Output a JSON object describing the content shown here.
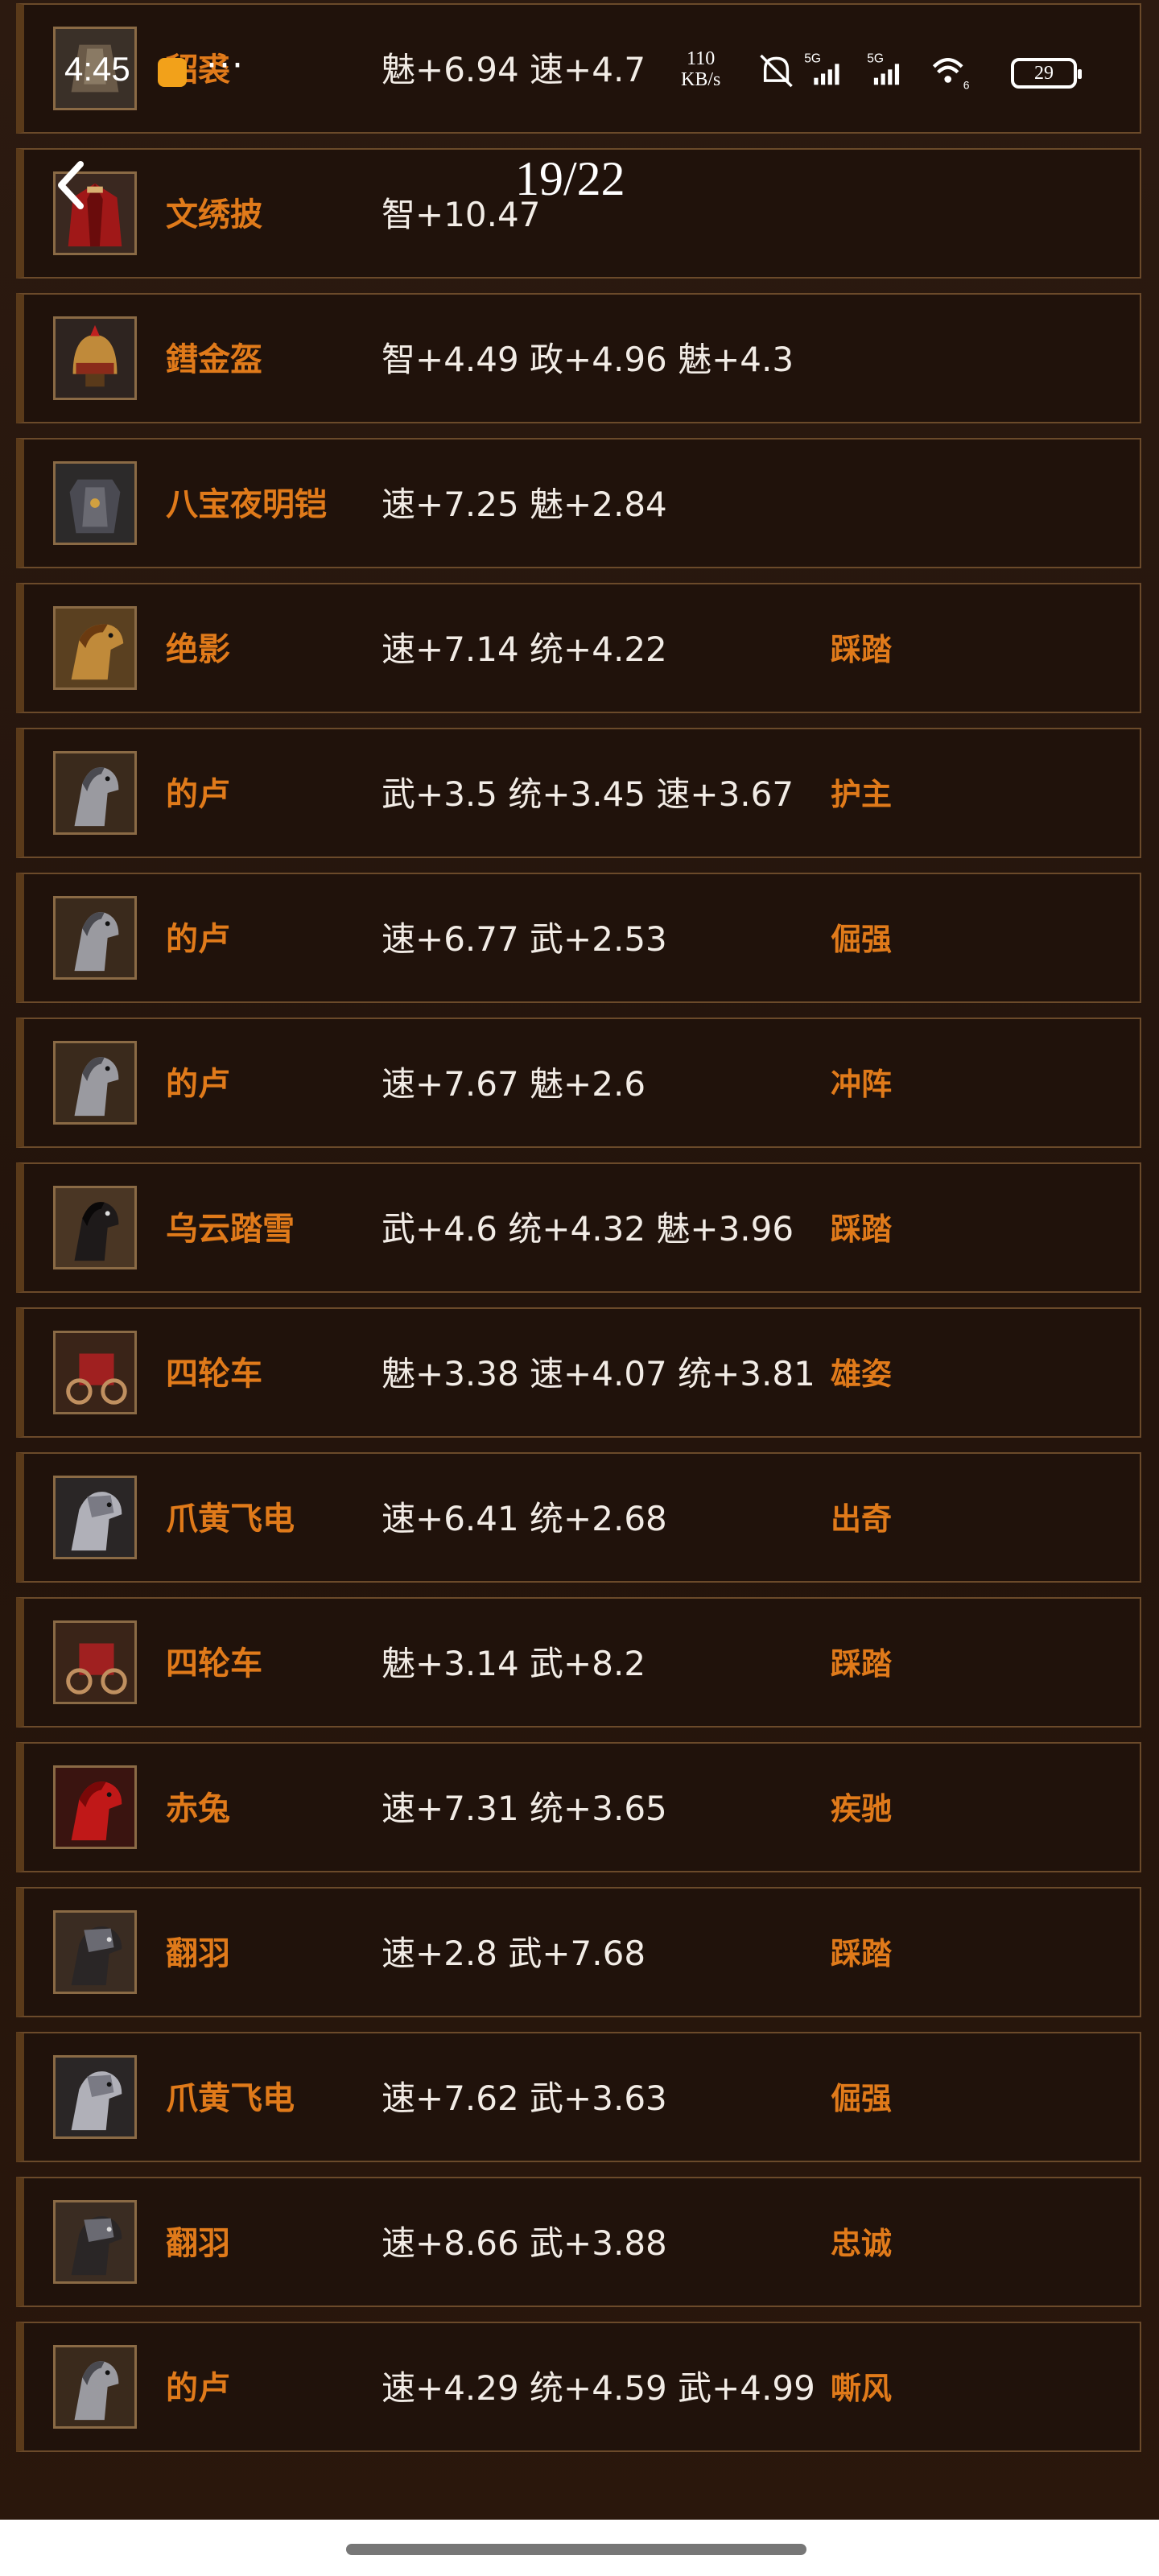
{
  "status_bar": {
    "time": "4:45",
    "more": "···",
    "net_speed_value": "110",
    "net_speed_unit": "KB/s",
    "battery": "29",
    "wifi_label": "6",
    "sim1": "5G",
    "sim2": "5G"
  },
  "header": {
    "page_counter": "19/22"
  },
  "items": [
    {
      "name": "貂裘",
      "stats": "魅+6.94 速+4.7",
      "skill": "",
      "icon": "fur-armor-icon"
    },
    {
      "name": "文绣披",
      "stats": "智+10.47",
      "skill": "",
      "icon": "cloak-icon"
    },
    {
      "name": "鏏金盔",
      "stats": "智+4.49 政+4.96 魅+4.3",
      "skill": "",
      "icon": "helmet-icon"
    },
    {
      "name": "八宝夜明铠",
      "stats": "速+7.25 魅+2.84",
      "skill": "",
      "icon": "armor-icon"
    },
    {
      "name": "绝影",
      "stats": "速+7.14 统+4.22",
      "skill": "踩踏",
      "icon": "horse-icon"
    },
    {
      "name": "的卢",
      "stats": "武+3.5 统+3.45 速+3.67",
      "skill": "护主",
      "icon": "horse-icon"
    },
    {
      "name": "的卢",
      "stats": "速+6.77 武+2.53",
      "skill": "倔强",
      "icon": "horse-icon"
    },
    {
      "name": "的卢",
      "stats": "速+7.67 魅+2.6",
      "skill": "冲阵",
      "icon": "horse-icon"
    },
    {
      "name": "乌云踏雪",
      "stats": "武+4.6 统+4.32 魅+3.96",
      "skill": "踩踏",
      "icon": "horse-icon"
    },
    {
      "name": "四轮车",
      "stats": "魅+3.38 速+4.07 统+3.81",
      "skill": "雄姿",
      "icon": "chariot-icon"
    },
    {
      "name": "爪黄飞电",
      "stats": "速+6.41 统+2.68",
      "skill": "出奇",
      "icon": "armored-horse-icon"
    },
    {
      "name": "四轮车",
      "stats": "魅+3.14 武+8.2",
      "skill": "踩踏",
      "icon": "chariot-icon"
    },
    {
      "name": "赤兔",
      "stats": "速+7.31 统+3.65",
      "skill": "疾驰",
      "icon": "red-horse-icon"
    },
    {
      "name": "翻羽",
      "stats": "速+2.8 武+7.68",
      "skill": "踩踏",
      "icon": "armored-horse-icon"
    },
    {
      "name": "爪黄飞电",
      "stats": "速+7.62 武+3.63",
      "skill": "倔强",
      "icon": "armored-horse-icon"
    },
    {
      "name": "翻羽",
      "stats": "速+8.66 武+3.88",
      "skill": "忠诚",
      "icon": "armored-horse-icon"
    },
    {
      "name": "的卢",
      "stats": "速+4.29 统+4.59 武+4.99",
      "skill": "嘶风",
      "icon": "horse-icon"
    }
  ],
  "colors": {
    "name": "#e07a1a",
    "skill": "#e07a1a",
    "stats": "#f2ece6",
    "row_border": "#6b4a2a",
    "row_bg": "#20120b"
  }
}
